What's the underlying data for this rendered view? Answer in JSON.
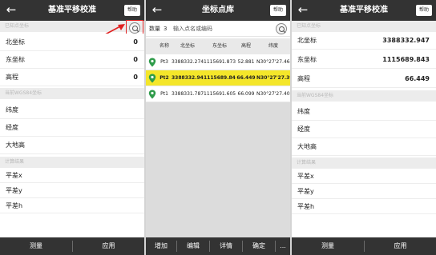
{
  "colors": {
    "bar": "#333333",
    "section_bg": "#ececec",
    "selected_row": "#f4e62a",
    "callout": "#e02020",
    "pin_green": "#2e9b4a"
  },
  "panel_left": {
    "title": "基准平移校准",
    "help_label": "帮助",
    "section_known": "已知点坐标",
    "north_label": "北坐标",
    "north_value": "0",
    "east_label": "东坐标",
    "east_value": "0",
    "height_label": "高程",
    "height_value": "0",
    "section_wgs": "当前WGS84坐标",
    "lat_label": "纬度",
    "lon_label": "经度",
    "geo_height_label": "大地高",
    "section_result": "计算结果",
    "dx_label": "平差x",
    "dy_label": "平差y",
    "dh_label": "平差h",
    "measure_label": "测量",
    "apply_label": "应用",
    "pick_icon": "pick-point-icon",
    "back_icon": "back-arrow-icon"
  },
  "panel_mid": {
    "title": "坐标点库",
    "help_label": "帮助",
    "count_label": "数量",
    "count_value": "3",
    "search_placeholder": "输入点名或编码",
    "columns": [
      "名称",
      "北坐标",
      "东坐标",
      "高程",
      "纬度"
    ],
    "rows": [
      {
        "name": "Pt3",
        "north": "3388332.274",
        "east": "1115691.873",
        "height": "52.881",
        "lat": "N30°27'27.46",
        "selected": false
      },
      {
        "name": "Pt2",
        "north": "3388332.947",
        "east": "1115689.843",
        "height": "66.449",
        "lat": "N30°27'27.39",
        "selected": true
      },
      {
        "name": "Pt1",
        "north": "3388331.787",
        "east": "1115691.605",
        "height": "66.099",
        "lat": "N30°27'27.40",
        "selected": false
      }
    ],
    "add_label": "增加",
    "edit_label": "编辑",
    "detail_label": "详情",
    "confirm_label": "确定",
    "more_label": "..."
  },
  "panel_right": {
    "title": "基准平移校准",
    "help_label": "帮助",
    "section_known": "已知点坐标",
    "north_label": "北坐标",
    "north_value": "3388332.947",
    "east_label": "东坐标",
    "east_value": "1115689.843",
    "height_label": "高程",
    "height_value": "66.449",
    "section_wgs": "当前WGS84坐标",
    "lat_label": "纬度",
    "lon_label": "经度",
    "geo_height_label": "大地高",
    "section_result": "计算结果",
    "dx_label": "平差x",
    "dy_label": "平差y",
    "dh_label": "平差h",
    "measure_label": "测量",
    "apply_label": "应用"
  }
}
